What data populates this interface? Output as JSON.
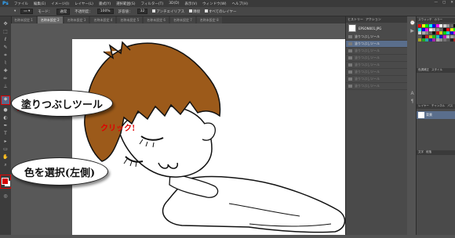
{
  "menubar": {
    "app_icon": "Ps",
    "items": [
      "ファイル",
      "編集(E)",
      "イメージ(I)",
      "レイヤー(L)",
      "書式(Y)",
      "選択範囲(S)",
      "フィルター(T)",
      "3D(D)",
      "表示(V)",
      "ウィンドウ(W)",
      "ヘルプ(H)"
    ],
    "controls": [
      "—",
      "▢",
      "✕"
    ]
  },
  "options": {
    "mode_label": "モード：",
    "mode_value": "通常",
    "opacity_label": "不透明度：",
    "opacity_value": "100%",
    "tolerance_label": "許容値：",
    "tolerance_value": "32",
    "antialias_label": "アンチエイリアス",
    "contiguous_label": "隣接",
    "all_layers_label": "すべてのレイヤー"
  },
  "tabs": [
    {
      "label": "名称未設定 1",
      "active": false
    },
    {
      "label": "名称未設定 2",
      "active": true
    },
    {
      "label": "名称未設定 3",
      "active": false
    },
    {
      "label": "名称未設定 4",
      "active": false
    },
    {
      "label": "名称未設定 5",
      "active": false
    },
    {
      "label": "名称未設定 6",
      "active": false
    },
    {
      "label": "名称未設定 7",
      "active": false
    },
    {
      "label": "名称未設定 8",
      "active": false
    }
  ],
  "annotations": {
    "callout_fill": "塗りつぶしツール",
    "callout_color": "色を選択(左側)",
    "click_label": "クリック!",
    "arrow_color": "#e00000"
  },
  "history": {
    "tabs": [
      "ヒストリー",
      "アクション"
    ],
    "snapshot": "EPSON001.JPG",
    "rows": [
      {
        "label": "塗りつぶしツール",
        "state": "normal"
      },
      {
        "label": "塗りつぶしツール",
        "state": "selected"
      },
      {
        "label": "塗りつぶしツール",
        "state": "dim"
      },
      {
        "label": "塗りつぶしツール",
        "state": "dim"
      },
      {
        "label": "塗りつぶしツール",
        "state": "dim"
      },
      {
        "label": "塗りつぶしツール",
        "state": "dim"
      },
      {
        "label": "塗りつぶしツール",
        "state": "dim"
      },
      {
        "label": "塗りつぶしツール",
        "state": "dim"
      }
    ]
  },
  "right_panel": {
    "panel_header": [
      "スウォッチ",
      "カラー"
    ],
    "adjust_header": [
      "色調補正",
      "スタイル"
    ],
    "layers_header": [
      "レイヤー",
      "チャンネル",
      "パス"
    ],
    "layer_name": "背景",
    "char_labels": [
      "文字",
      "段落"
    ]
  },
  "colors": {
    "accent_red": "#e00000",
    "hair_brown": "#9c5a1a",
    "foreground": "#d40000",
    "background": "#ffffff"
  }
}
